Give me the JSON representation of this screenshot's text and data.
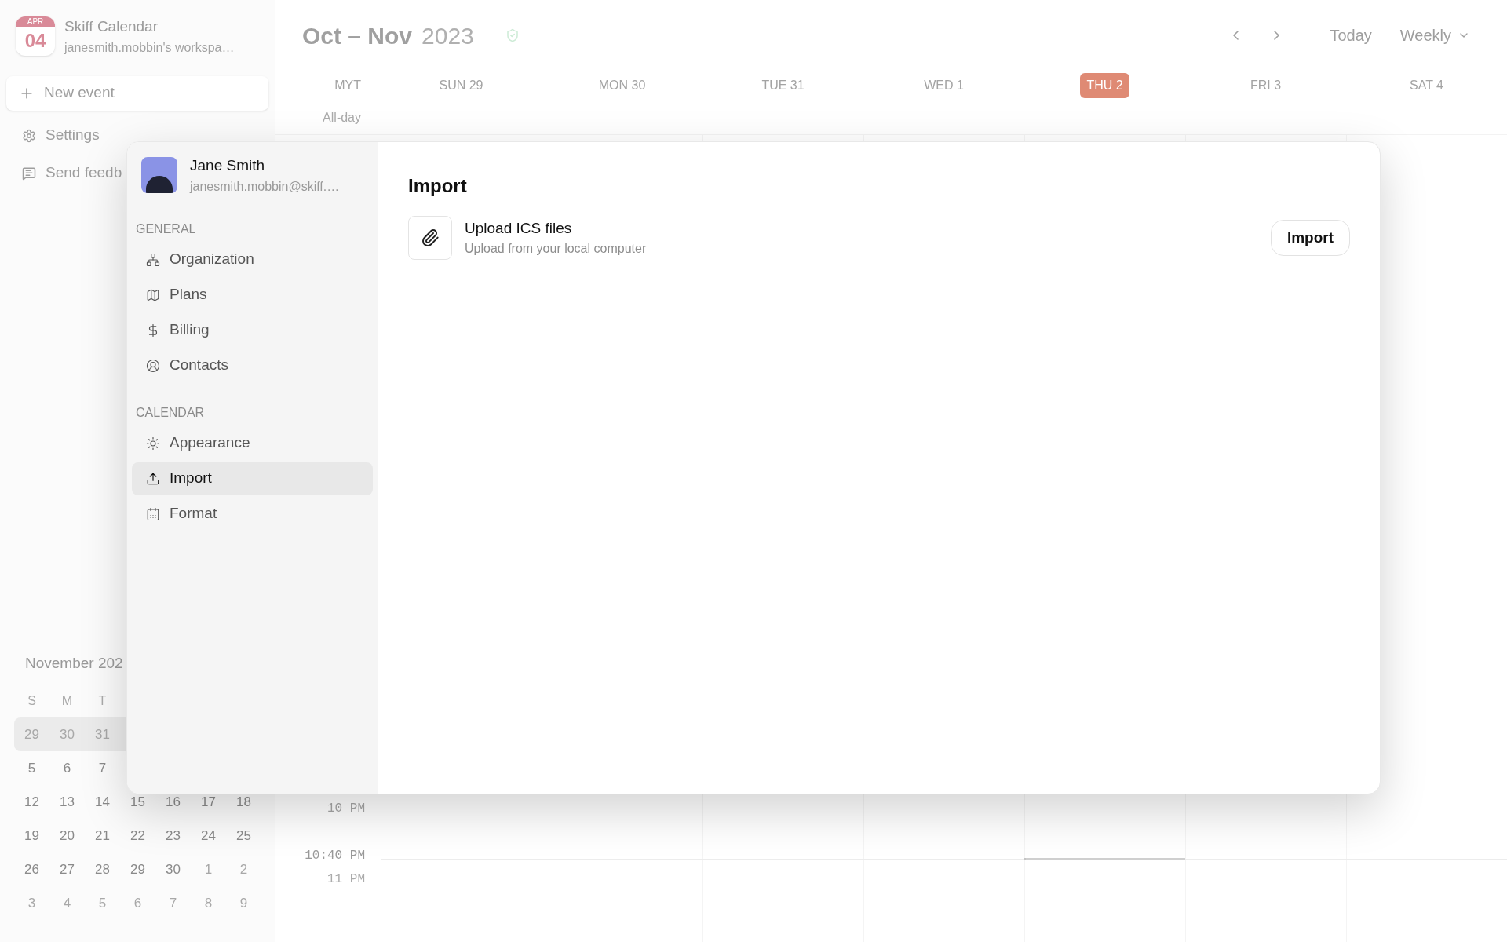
{
  "app": {
    "logo_month": "APR",
    "logo_day": "04",
    "title": "Skiff Calendar",
    "workspace": "janesmith.mobbin's workspa…"
  },
  "sidebar": {
    "new_event": "New event",
    "items": [
      {
        "label": "Settings"
      },
      {
        "label": "Send feedb"
      }
    ]
  },
  "mini_calendar": {
    "title": "November 202",
    "weekdays": [
      "S",
      "M",
      "T"
    ],
    "weeks": [
      {
        "current": true,
        "days": [
          {
            "day": "29",
            "muted": true
          },
          {
            "day": "30",
            "muted": true
          },
          {
            "day": "31",
            "muted": true
          }
        ]
      },
      {
        "current": false,
        "days": [
          {
            "day": "5",
            "muted": false
          },
          {
            "day": "6",
            "muted": false
          },
          {
            "day": "7",
            "muted": false
          }
        ]
      },
      {
        "current": false,
        "days": [
          {
            "day": "12",
            "muted": false
          },
          {
            "day": "13",
            "muted": false
          },
          {
            "day": "14",
            "muted": false
          },
          {
            "day": "15",
            "muted": false
          },
          {
            "day": "16",
            "muted": false
          },
          {
            "day": "17",
            "muted": false
          },
          {
            "day": "18",
            "muted": false
          }
        ]
      },
      {
        "current": false,
        "days": [
          {
            "day": "19",
            "muted": false
          },
          {
            "day": "20",
            "muted": false
          },
          {
            "day": "21",
            "muted": false
          },
          {
            "day": "22",
            "muted": false
          },
          {
            "day": "23",
            "muted": false
          },
          {
            "day": "24",
            "muted": false
          },
          {
            "day": "25",
            "muted": false
          }
        ]
      },
      {
        "current": false,
        "days": [
          {
            "day": "26",
            "muted": false
          },
          {
            "day": "27",
            "muted": false
          },
          {
            "day": "28",
            "muted": false
          },
          {
            "day": "29",
            "muted": false
          },
          {
            "day": "30",
            "muted": false
          },
          {
            "day": "1",
            "muted": true
          },
          {
            "day": "2",
            "muted": true
          }
        ]
      },
      {
        "current": false,
        "days": [
          {
            "day": "3",
            "muted": true
          },
          {
            "day": "4",
            "muted": true
          },
          {
            "day": "5",
            "muted": true
          },
          {
            "day": "6",
            "muted": true
          },
          {
            "day": "7",
            "muted": true
          },
          {
            "day": "8",
            "muted": true
          },
          {
            "day": "9",
            "muted": true
          }
        ]
      }
    ]
  },
  "calendar": {
    "range": "Oct – Nov",
    "year": "2023",
    "today_button": "Today",
    "view": "Weekly",
    "timezone": "MYT",
    "all_day": "All-day",
    "days": [
      {
        "label": "SUN 29",
        "today": false
      },
      {
        "label": "MON 30",
        "today": false
      },
      {
        "label": "TUE 31",
        "today": false
      },
      {
        "label": "WED 1",
        "today": false
      },
      {
        "label": "THU 2",
        "today": true
      },
      {
        "label": "FRI 3",
        "today": false
      },
      {
        "label": "SAT 4",
        "today": false
      }
    ],
    "times": [
      {
        "label": "10 PM",
        "kind": "hour"
      },
      {
        "label": "10:40 PM",
        "kind": "now"
      },
      {
        "label": "11 PM",
        "kind": "hour"
      }
    ]
  },
  "settings_dialog": {
    "user": {
      "name": "Jane Smith",
      "email": "janesmith.mobbin@skiff.…"
    },
    "sections": [
      {
        "heading": "GENERAL",
        "items": [
          {
            "label": "Organization",
            "selected": false
          },
          {
            "label": "Plans",
            "selected": false
          },
          {
            "label": "Billing",
            "selected": false
          },
          {
            "label": "Contacts",
            "selected": false
          }
        ]
      },
      {
        "heading": "CALENDAR",
        "items": [
          {
            "label": "Appearance",
            "selected": false
          },
          {
            "label": "Import",
            "selected": true
          },
          {
            "label": "Format",
            "selected": false
          }
        ]
      }
    ],
    "content": {
      "title": "Import",
      "rows": [
        {
          "title": "Upload ICS files",
          "subtitle": "Upload from your local computer",
          "button": "Import"
        }
      ]
    }
  }
}
